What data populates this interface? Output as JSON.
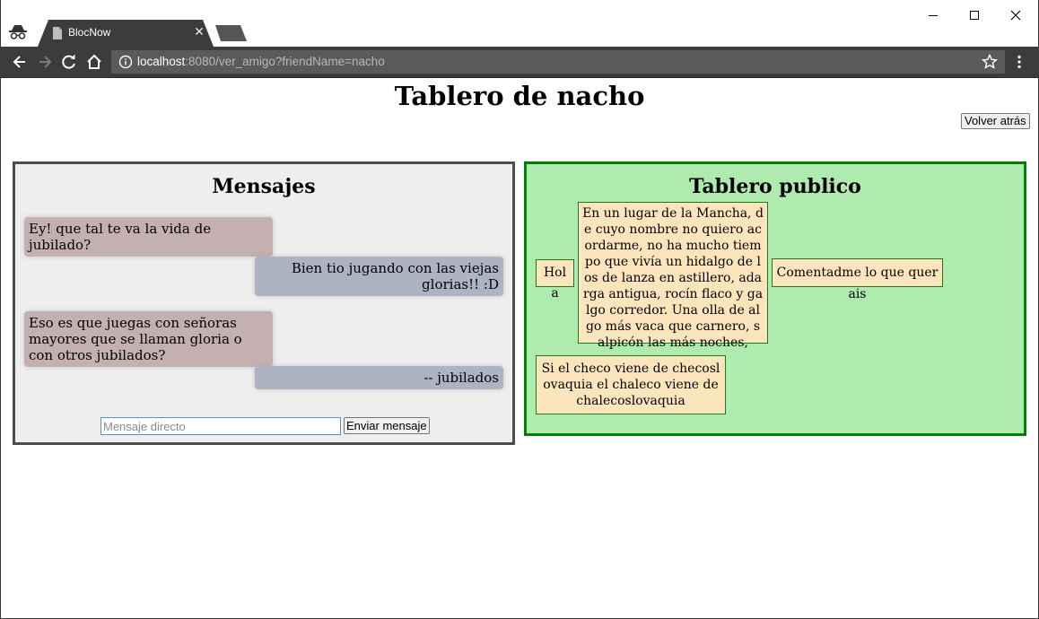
{
  "browser": {
    "tab_title": "BlocNow",
    "url_host": "localhost",
    "url_rest": ":8080/ver_amigo?friendName=nacho"
  },
  "page": {
    "title": "Tablero de nacho",
    "back_label": "Volver atrás"
  },
  "messages_panel": {
    "heading": "Mensajes",
    "items": [
      {
        "text": "Ey! que tal te va la vida de jubilado?",
        "direction": "in"
      },
      {
        "text": "Bien tio jugando con las viejas glorias!! :D",
        "direction": "out"
      },
      {
        "text": "Eso es que juegas con señoras mayores que se llaman gloria o con otros jubilados?",
        "direction": "in"
      },
      {
        "text": "-- jubilados",
        "direction": "out"
      }
    ],
    "input_placeholder": "Mensaje directo",
    "input_value": "",
    "send_label": "Enviar mensaje"
  },
  "board_panel": {
    "heading": "Tablero publico",
    "notes": [
      {
        "text": "Hola"
      },
      {
        "text": "En un lugar de la Mancha, de cuyo nombre no quiero acordarme, no ha mucho tiempo que vivía un hidalgo de los de lanza en astillero, adarga antigua, rocín flaco y galgo corredor. Una olla de algo más vaca que carnero, salpicón las más noches,"
      },
      {
        "text": "Comentadme lo que querais"
      },
      {
        "text": "Si el checo viene de checoslovaquia el chaleco viene de chalecoslovaquia"
      }
    ]
  },
  "colors": {
    "messages_bg": "#efefef",
    "messages_border": "#4d4d4d",
    "board_bg": "#afeaaf",
    "board_border": "#008000",
    "note_bg": "#fce5bd",
    "incoming_bubble": "#c4b0b0",
    "outgoing_bubble": "#aeb3c4",
    "toolbar_bg": "#3c3c3c"
  }
}
